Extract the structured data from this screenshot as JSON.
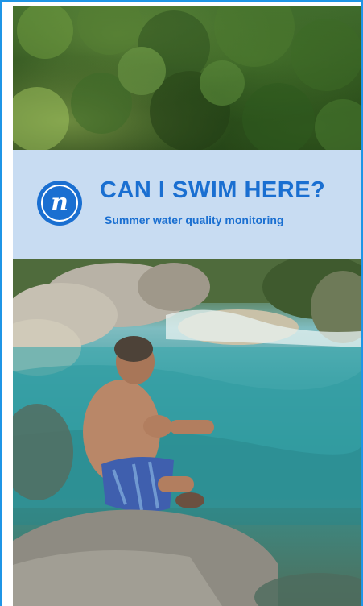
{
  "banner": {
    "title": "CAN I SWIM HERE?",
    "subtitle": "Summer water quality monitoring",
    "logo_letter": "n",
    "logo_icon": "swim-logo-icon"
  },
  "images": {
    "top": "forest-photo",
    "bottom": "river-swimmer-photo"
  },
  "colors": {
    "accent": "#1a6fd1",
    "banner_bg": "#c8dcf2",
    "edge": "#1f95e6"
  }
}
